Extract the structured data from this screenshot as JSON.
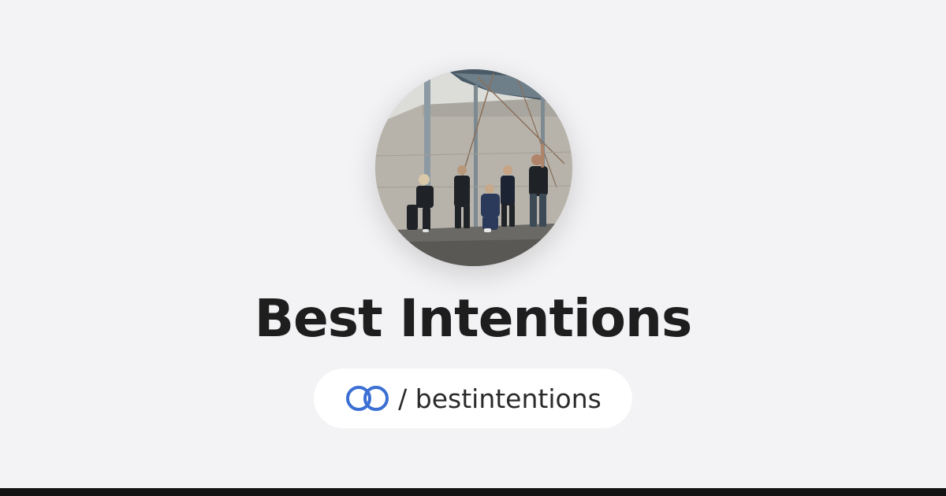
{
  "profile": {
    "name": "Best Intentions",
    "handle": "/ bestintentions",
    "avatar_alt": "Best Intentions band photo"
  },
  "brand": {
    "icon": "linked-rings-icon",
    "accent": "#3b6fd4",
    "background": "#f3f3f5",
    "footer": "#131313"
  }
}
